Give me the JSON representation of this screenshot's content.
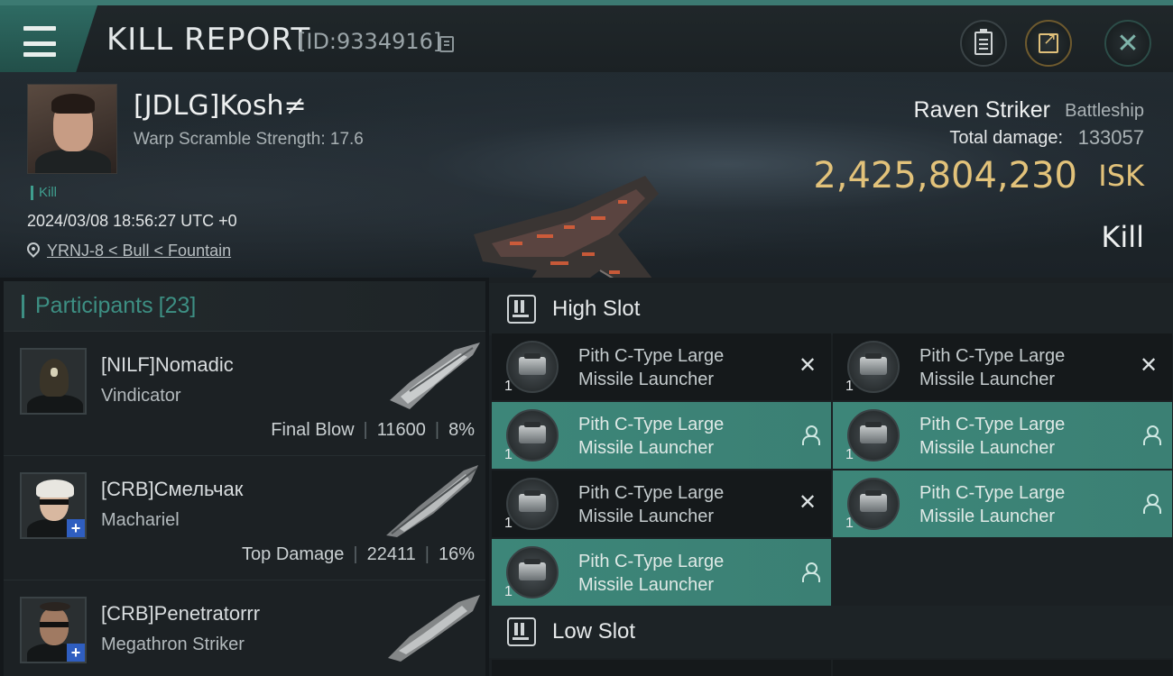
{
  "header": {
    "title": "KILL REPORT",
    "report_id": "[ID:9334916]",
    "icons": {
      "menu": "hamburger-menu-icon",
      "copy": "copy-icon",
      "clipboard": "clipboard-icon",
      "share": "share-icon",
      "close": "close-icon"
    }
  },
  "victim": {
    "pilot_name": "[JDLG]Kosh≠",
    "warp_scramble": "Warp Scramble Strength: 17.6",
    "tag": "Kill",
    "datetime": "2024/03/08 18:56:27 UTC +0",
    "location": "YRNJ-8 < Bull < Fountain",
    "ship_name": "Raven Striker",
    "ship_class": "Battleship",
    "total_damage_label": "Total damage:",
    "total_damage": "133057",
    "isk_value": "2,425,804,230",
    "isk_unit": "ISK",
    "result": "Kill"
  },
  "participants": {
    "label": "Participants",
    "count": "[23]",
    "rows": [
      {
        "name": "[NILF]Nomadic",
        "ship": "Vindicator",
        "role": "Final Blow",
        "damage": "11600",
        "percent": "8%",
        "badge": ""
      },
      {
        "name": "[CRB]Смельчак",
        "ship": "Machariel",
        "role": "Top Damage",
        "damage": "22411",
        "percent": "16%",
        "badge": "+"
      },
      {
        "name": "[CRB]Penetratorrr",
        "ship": "Megathron Striker",
        "role": "",
        "damage": "",
        "percent": "",
        "badge": "+"
      }
    ]
  },
  "slots": {
    "high_label": "High Slot",
    "low_label": "Low Slot",
    "high_modules": [
      {
        "line1": "Pith C-Type Large",
        "line2": "Missile Launcher",
        "qty": "1",
        "status": "destroyed"
      },
      {
        "line1": "Pith C-Type Large",
        "line2": "Missile Launcher",
        "qty": "1",
        "status": "destroyed"
      },
      {
        "line1": "Pith C-Type Large",
        "line2": "Missile Launcher",
        "qty": "1",
        "status": "dropped"
      },
      {
        "line1": "Pith C-Type Large",
        "line2": "Missile Launcher",
        "qty": "1",
        "status": "dropped"
      },
      {
        "line1": "Pith C-Type Large",
        "line2": "Missile Launcher",
        "qty": "1",
        "status": "destroyed"
      },
      {
        "line1": "Pith C-Type Large",
        "line2": "Missile Launcher",
        "qty": "1",
        "status": "dropped"
      },
      {
        "line1": "Pith C-Type Large",
        "line2": "Missile Launcher",
        "qty": "1",
        "status": "dropped"
      }
    ],
    "status_glyph_destroyed": "✕"
  },
  "colors": {
    "accent_teal": "#3d8f83",
    "isk_gold": "#e2c27a",
    "dropped_row": "#3d8679",
    "destroyed_row": "#15191b"
  }
}
